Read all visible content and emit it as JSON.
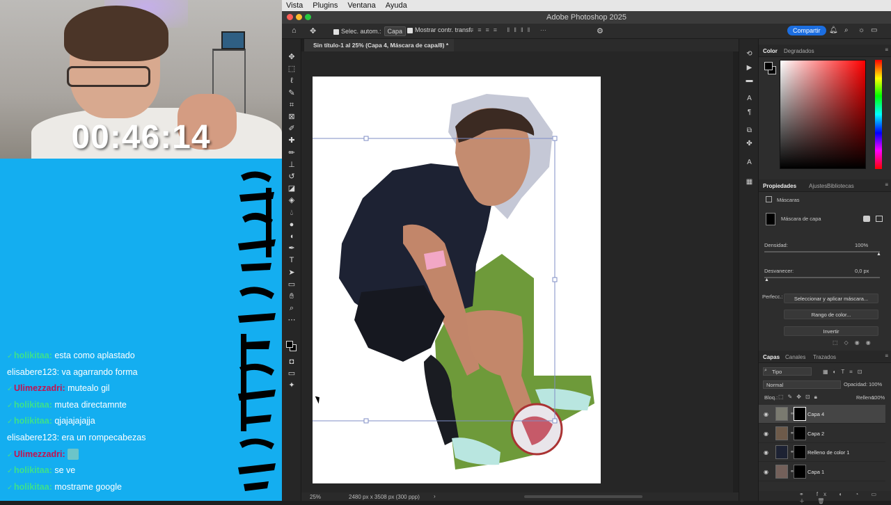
{
  "stream": {
    "timer": "00:46:14",
    "chat": [
      {
        "user": "holikitaa:",
        "message": "esta como aplastado",
        "style": "green",
        "badge": true
      },
      {
        "user": "elisabere123:",
        "message": "va agarrando forma",
        "style": "plain",
        "badge": false
      },
      {
        "user": "Ulimezzadri:",
        "message": "mutealo gil",
        "style": "red",
        "badge": true
      },
      {
        "user": "holikitaa:",
        "message": "mutea directamnte",
        "style": "green",
        "badge": true
      },
      {
        "user": "holikitaa:",
        "message": "qjajajajajja",
        "style": "green",
        "badge": true
      },
      {
        "user": "elisabere123:",
        "message": "era un rompecabezas",
        "style": "plain",
        "badge": false
      },
      {
        "user": "Ulimezzadri:",
        "message": "",
        "style": "red",
        "badge": true,
        "emote": true
      },
      {
        "user": "holikitaa:",
        "message": "se ve",
        "style": "green",
        "badge": true
      },
      {
        "user": "holikitaa:",
        "message": "mostrame google",
        "style": "green",
        "badge": true
      }
    ]
  },
  "mac_menu": [
    "Vista",
    "Plugins",
    "Ventana",
    "Ayuda"
  ],
  "window_title": "Adobe Photoshop 2025",
  "options_bar": {
    "auto_select_label": "Selec. autom.:",
    "auto_select_value": "Capa",
    "show_transform_label": "Mostrar contr. transf.",
    "share_label": "Compartir"
  },
  "document_tab": "Sin título-1 al 25% (Capa 4, Máscara de capa/8) *",
  "status": {
    "zoom": "25%",
    "doc_size": "2480 px x 3508 px (300 ppp)"
  },
  "color_panel": {
    "tabs": [
      "Color",
      "Degradados"
    ]
  },
  "properties_panel": {
    "tabs": [
      "Propiedades",
      "Ajustes",
      "Bibliotecas"
    ],
    "section": "Máscaras",
    "mask_label": "Máscara de capa",
    "density_label": "Densidad:",
    "density_value": "100%",
    "feather_label": "Desvanecer:",
    "feather_value": "0,0 px",
    "refine_label": "Perfecc.:",
    "buttons": [
      "Seleccionar y aplicar máscara...",
      "Rango de color...",
      "Invertir"
    ]
  },
  "layers_panel": {
    "tabs": [
      "Capas",
      "Canales",
      "Trazados"
    ],
    "filter_label": "Tipo",
    "blend_mode": "Normal",
    "opacity_label": "Opacidad:",
    "opacity_value": "100%",
    "lock_label": "Bloq.:",
    "fill_label": "Relleno:",
    "fill_value": "100%",
    "layers": [
      {
        "name": "Capa 4",
        "selected": true
      },
      {
        "name": "Capa 2",
        "selected": false
      },
      {
        "name": "Relleno de color 1",
        "selected": false
      },
      {
        "name": "Capa 1",
        "selected": false
      }
    ]
  },
  "colors": {
    "stream_bg": "#14aef0",
    "chat_green": "#3ce08e",
    "chat_red": "#c4114f",
    "ps_accent": "#1c6ee0",
    "shirt_navy": "#1d2233",
    "grass_green": "#6e9a3a"
  }
}
